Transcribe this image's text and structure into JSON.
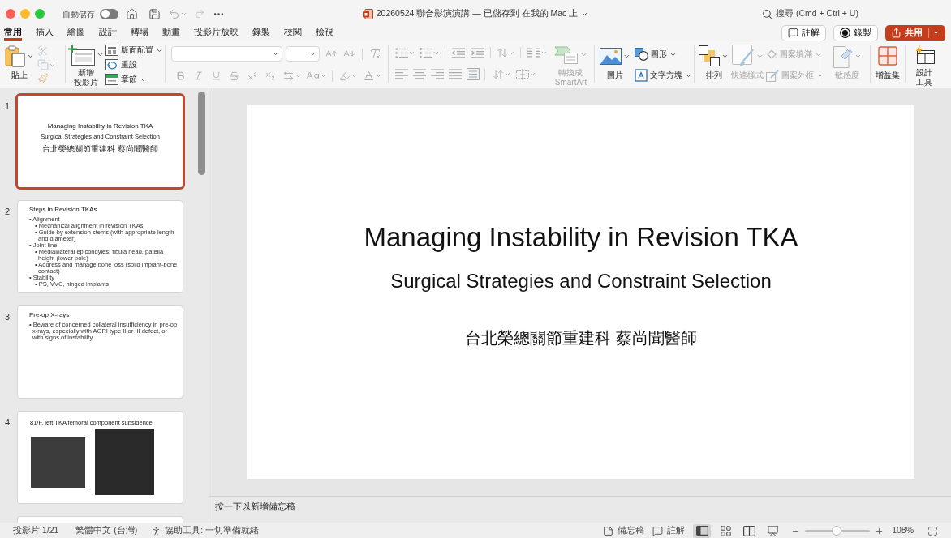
{
  "titlebar": {
    "autosave": {
      "label": "自動儲存",
      "on": false
    },
    "document_title": "20260524 聯合影演演講 — 已儲存到 在我的 Mac 上",
    "search": {
      "placeholder": "搜尋 (Cmd + Ctrl + U)"
    }
  },
  "tabs": [
    {
      "label": "常用",
      "selected": true
    },
    {
      "label": "插入",
      "selected": false
    },
    {
      "label": "繪圖",
      "selected": false
    },
    {
      "label": "設計",
      "selected": false
    },
    {
      "label": "轉場",
      "selected": false
    },
    {
      "label": "動畫",
      "selected": false
    },
    {
      "label": "投影片放映",
      "selected": false
    },
    {
      "label": "錄製",
      "selected": false
    },
    {
      "label": "校閱",
      "selected": false
    },
    {
      "label": "檢視",
      "selected": false
    }
  ],
  "header_buttons": [
    {
      "kind": "comments",
      "label": "註解"
    },
    {
      "kind": "record",
      "label": "錄製"
    },
    {
      "kind": "share",
      "label": "共用"
    }
  ],
  "ribbon": {
    "paste": {
      "label": "貼上",
      "disabled": false
    },
    "clipboard_tools": {
      "disabled": true
    },
    "new_slide": {
      "label_lines": [
        "新增",
        "投影片"
      ],
      "disabled": false
    },
    "slide_menu": [
      {
        "kind": "layout",
        "label": "版面配置",
        "disabled": false
      },
      {
        "kind": "reset",
        "label": "重設",
        "disabled": false
      },
      {
        "kind": "section",
        "label": "章節",
        "disabled": false
      }
    ],
    "font": {
      "disabled": true
    },
    "paragraph": {
      "disabled": true
    },
    "smartart": {
      "label": "轉換成 SmartArt",
      "disabled": true
    },
    "picture": {
      "label": "圖片",
      "disabled": false
    },
    "insert_menu": [
      {
        "kind": "shapes",
        "label": "圖形",
        "disabled": false
      },
      {
        "kind": "textbox",
        "label": "文字方塊",
        "disabled": false
      }
    ],
    "arrange": {
      "label": "排列",
      "disabled": false
    },
    "quick_styles": {
      "label": "快速樣式",
      "disabled": true
    },
    "shape_menu": [
      {
        "kind": "fill",
        "label": "圖案填滿",
        "disabled": true
      },
      {
        "kind": "outline",
        "label": "圖案外框",
        "disabled": true
      }
    ],
    "sensitivity": {
      "label": "敏感度",
      "disabled": true
    },
    "addins": {
      "label": "增益集",
      "disabled": false
    },
    "designer": {
      "label_lines": [
        "設計",
        "工具"
      ],
      "disabled": false
    }
  },
  "thumbnails": [
    {
      "number": "1",
      "selected": true,
      "kind": "title",
      "title": "Managing Instability in Revision TKA",
      "subtitle": "Surgical Strategies and Constraint Selection",
      "author": "台北榮總關節重建科 蔡尚聞醫師"
    },
    {
      "number": "2",
      "selected": false,
      "kind": "bullets",
      "title": "Steps in Revision TKAs",
      "bullets": [
        {
          "text": "• Alignment",
          "children": [
            {
              "text": "• Mechanical alignment in revision TKAs"
            },
            {
              "text": "• Guide by extension stems (with appropriate length and diameter)"
            }
          ]
        },
        {
          "text": "• Joint line",
          "children": [
            {
              "text": "• Medial/lateral epicondyles, fibula head, patella height (lower pole)"
            },
            {
              "text": "• Address and manage bone loss (solid implant-bone contact)"
            }
          ]
        },
        {
          "text": "• Stability",
          "children": [
            {
              "text": "• PS, VVC, hinged implants"
            }
          ]
        }
      ]
    },
    {
      "number": "3",
      "selected": false,
      "kind": "bullets",
      "title": "Pre-op X-rays",
      "bullets": [
        {
          "text": "• Beware of concerned collateral insufficiency in pre-op x-rays, especially with AORI type II or III defect, or with signs of instability"
        }
      ]
    },
    {
      "number": "4",
      "selected": false,
      "kind": "images",
      "caption": "81/F, left TKA femoral component subsidence"
    },
    {
      "selected": false,
      "kind": "blank"
    }
  ],
  "slide": {
    "title": "Managing Instability in Revision TKA",
    "subtitle": "Surgical Strategies and Constraint Selection",
    "author": "台北榮總關節重建科 蔡尚聞醫師"
  },
  "notes": {
    "placeholder": "按一下以新增備忘稿"
  },
  "status_bar": {
    "slide_position": "投影片 1/21",
    "language": "繁體中文 (台灣)",
    "accessibility": "協助工具: 一切準備就緒",
    "notes_button": "備忘稿",
    "comments_button": "註解",
    "views": [
      {
        "kind": "normal",
        "selected": true
      },
      {
        "kind": "sorter",
        "selected": false
      },
      {
        "kind": "reading",
        "selected": false
      },
      {
        "kind": "slideshow",
        "selected": false
      }
    ],
    "zoom": {
      "level": 0.49,
      "reading": "108%"
    }
  }
}
